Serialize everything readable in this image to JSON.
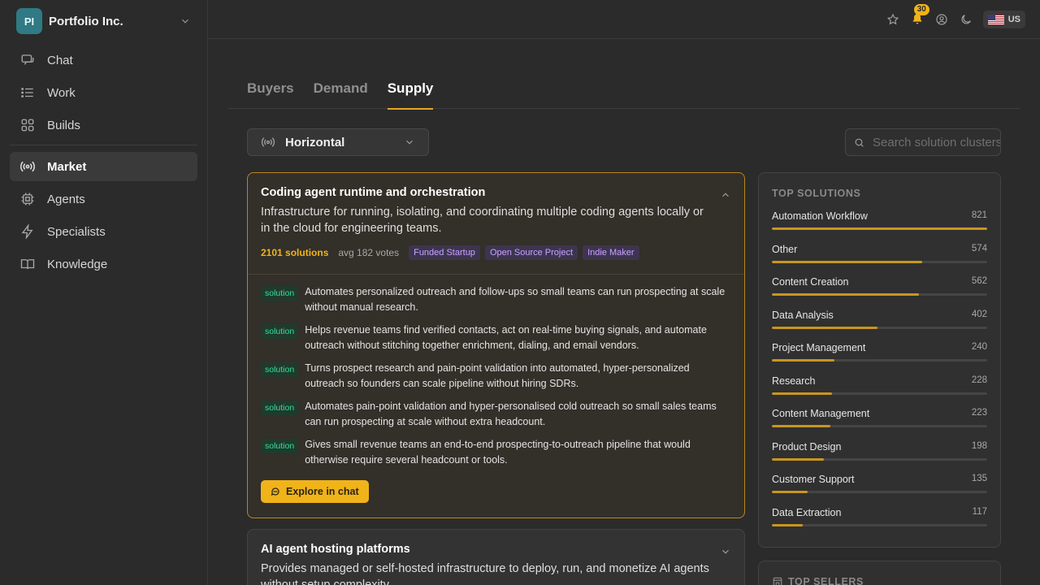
{
  "org": {
    "initials": "PI",
    "name": "Portfolio Inc."
  },
  "nav": {
    "primary": [
      {
        "label": "Chat",
        "icon": "chat-icon"
      },
      {
        "label": "Work",
        "icon": "list-icon"
      },
      {
        "label": "Builds",
        "icon": "grid-icon"
      }
    ],
    "secondary": [
      {
        "label": "Market",
        "icon": "broadcast-icon",
        "active": true
      },
      {
        "label": "Agents",
        "icon": "chip-icon"
      },
      {
        "label": "Specialists",
        "icon": "bolt-icon"
      },
      {
        "label": "Knowledge",
        "icon": "book-icon"
      }
    ]
  },
  "topbar": {
    "notifications": "30",
    "locale": "US"
  },
  "tabs": [
    "Buyers",
    "Demand",
    "Supply"
  ],
  "active_tab": "Supply",
  "filter": {
    "selected": "Horizontal"
  },
  "search": {
    "placeholder": "Search solution clusters"
  },
  "clusters": [
    {
      "title": "Coding agent runtime and orchestration",
      "description": "Infrastructure for running, isolating, and coordinating multiple coding agents locally or in the cloud for engineering teams.",
      "count": "2101 solutions",
      "avg": "avg 182 votes",
      "tags": [
        "Funded Startup",
        "Open Source Project",
        "Indie Maker"
      ],
      "solution_badge": "solution",
      "solutions": [
        "Automates personalized outreach and follow-ups so small teams can run prospecting at scale without manual research.",
        "Helps revenue teams find verified contacts, act on real-time buying signals, and automate outreach without stitching together enrichment, dialing, and email vendors.",
        "Turns prospect research and pain-point validation into automated, hyper-personalized outreach so founders can scale pipeline without hiring SDRs.",
        "Automates pain-point validation and hyper-personalised cold outreach so small sales teams can run prospecting at scale without extra headcount.",
        "Gives small revenue teams an end-to-end prospecting-to-outreach pipeline that would otherwise require several headcount or tools."
      ],
      "cta": "Explore in chat"
    },
    {
      "title": "AI agent hosting platforms",
      "description": "Provides managed or self-hosted infrastructure to deploy, run, and monetize AI agents without setup complexity."
    }
  ],
  "top_solutions": {
    "title": "TOP SOLUTIONS",
    "max": 821,
    "items": [
      {
        "name": "Automation Workflow",
        "value": 821
      },
      {
        "name": "Other",
        "value": 574
      },
      {
        "name": "Content Creation",
        "value": 562
      },
      {
        "name": "Data Analysis",
        "value": 402
      },
      {
        "name": "Project Management",
        "value": 240
      },
      {
        "name": "Research",
        "value": 228
      },
      {
        "name": "Content Management",
        "value": 223
      },
      {
        "name": "Product Design",
        "value": 198
      },
      {
        "name": "Customer Support",
        "value": 135
      },
      {
        "name": "Data Extraction",
        "value": 117
      }
    ]
  },
  "top_sellers": {
    "title": "TOP SELLERS"
  },
  "colors": {
    "accent": "#f0b31a",
    "solution_badge": "#3ddc97",
    "tag": "#c9a3ff"
  }
}
